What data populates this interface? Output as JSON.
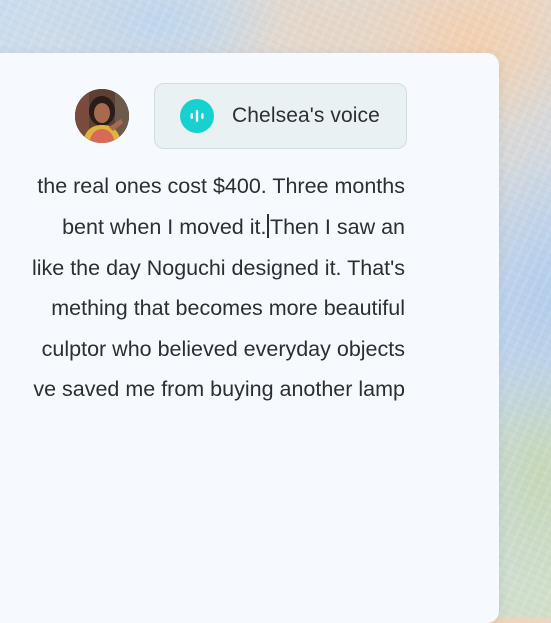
{
  "header": {
    "voice_label": "Chelsea's voice",
    "voice_icon": "audio-waveform-icon",
    "accent_color": "#16d1d0"
  },
  "editor": {
    "lines": [
      " the real ones cost $400. Three months",
      "bent when I moved it.",
      "Then I saw an",
      " like the day Noguchi designed it. That's",
      "mething that becomes more beautiful",
      "culptor who believed everyday objects",
      "ve saved me from buying another lamp"
    ]
  }
}
